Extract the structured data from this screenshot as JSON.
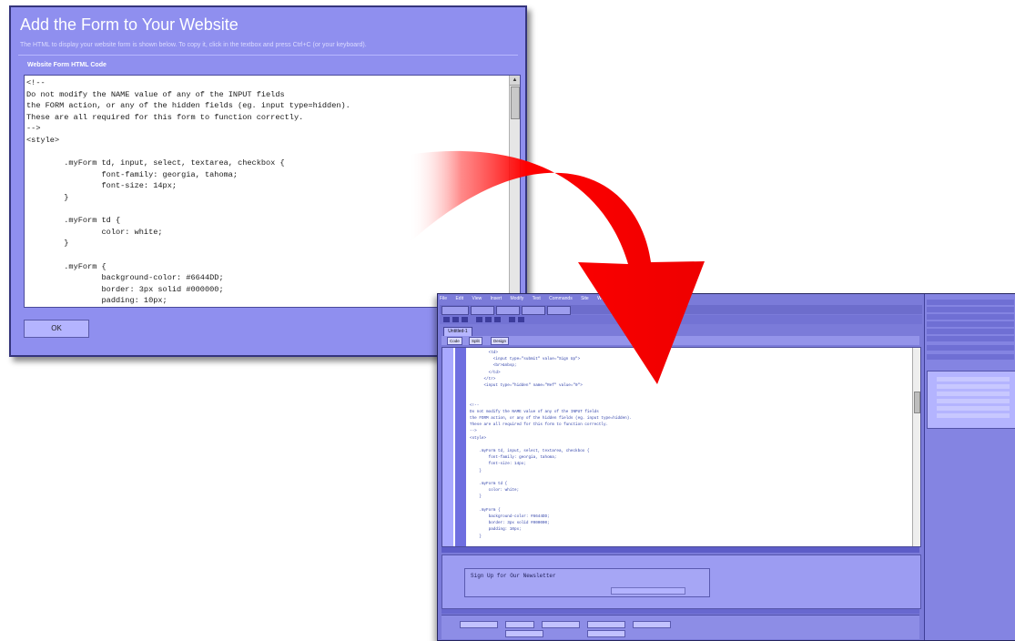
{
  "dialog": {
    "title": "Add the Form to Your Website",
    "description": "The HTML to display your website form is shown below. To copy it, click in the textbox and press Ctrl+C (or your keyboard).",
    "section_label": "Website Form HTML Code",
    "code": "<!--\nDo not modify the NAME value of any of the INPUT fields\nthe FORM action, or any of the hidden fields (eg. input type=hidden).\nThese are all required for this form to function correctly.\n-->\n<style>\n\n        .myForm td, input, select, textarea, checkbox {\n                font-family: georgia, tahoma;\n                font-size: 14px;\n        }\n\n        .myForm td {\n                color: white;\n        }\n\n        .myForm {\n                background-color: #6644DD;\n                border: 3px solid #000000;\n                padding: 10px;\n        }",
    "ok_label": "OK"
  },
  "editor": {
    "menu_items": [
      "File",
      "Edit",
      "View",
      "Insert",
      "Modify",
      "Text",
      "Commands",
      "Site",
      "Window",
      "Help"
    ],
    "doc_tab": "Untitled-1",
    "view_buttons": [
      "Code",
      "Split",
      "Design"
    ],
    "code": "        <td>\n          <input type=\"submit\" value=\"Sign Up\">\n          <br>&nbsp;\n        </td>\n      </tr>\n      <input type=\"hidden\" name=\"Ref\" value=\"0\">\n\n\n<!--\nDo not modify the NAME value of any of the INPUT fields\nthe FORM action, or any of the hidden fields (eg. input type=hidden).\nThese are all required for this form to function correctly.\n-->\n<style>\n\n    .myForm td, input, select, textarea, checkbox {\n        font-family: georgia, tahoma;\n        font-size: 14px;\n    }\n\n    .myForm td {\n        color: white;\n    }\n\n    .myForm {\n        background-color: #6644DD;\n        border: 3px solid #000000;\n        padding: 10px;\n    }",
    "design_label": "Sign Up for Our Newsletter"
  },
  "colors": {
    "dialog_bg": "#8f8fef",
    "arrow": "#ff0000",
    "editor_bg": "#7b7bd9"
  }
}
